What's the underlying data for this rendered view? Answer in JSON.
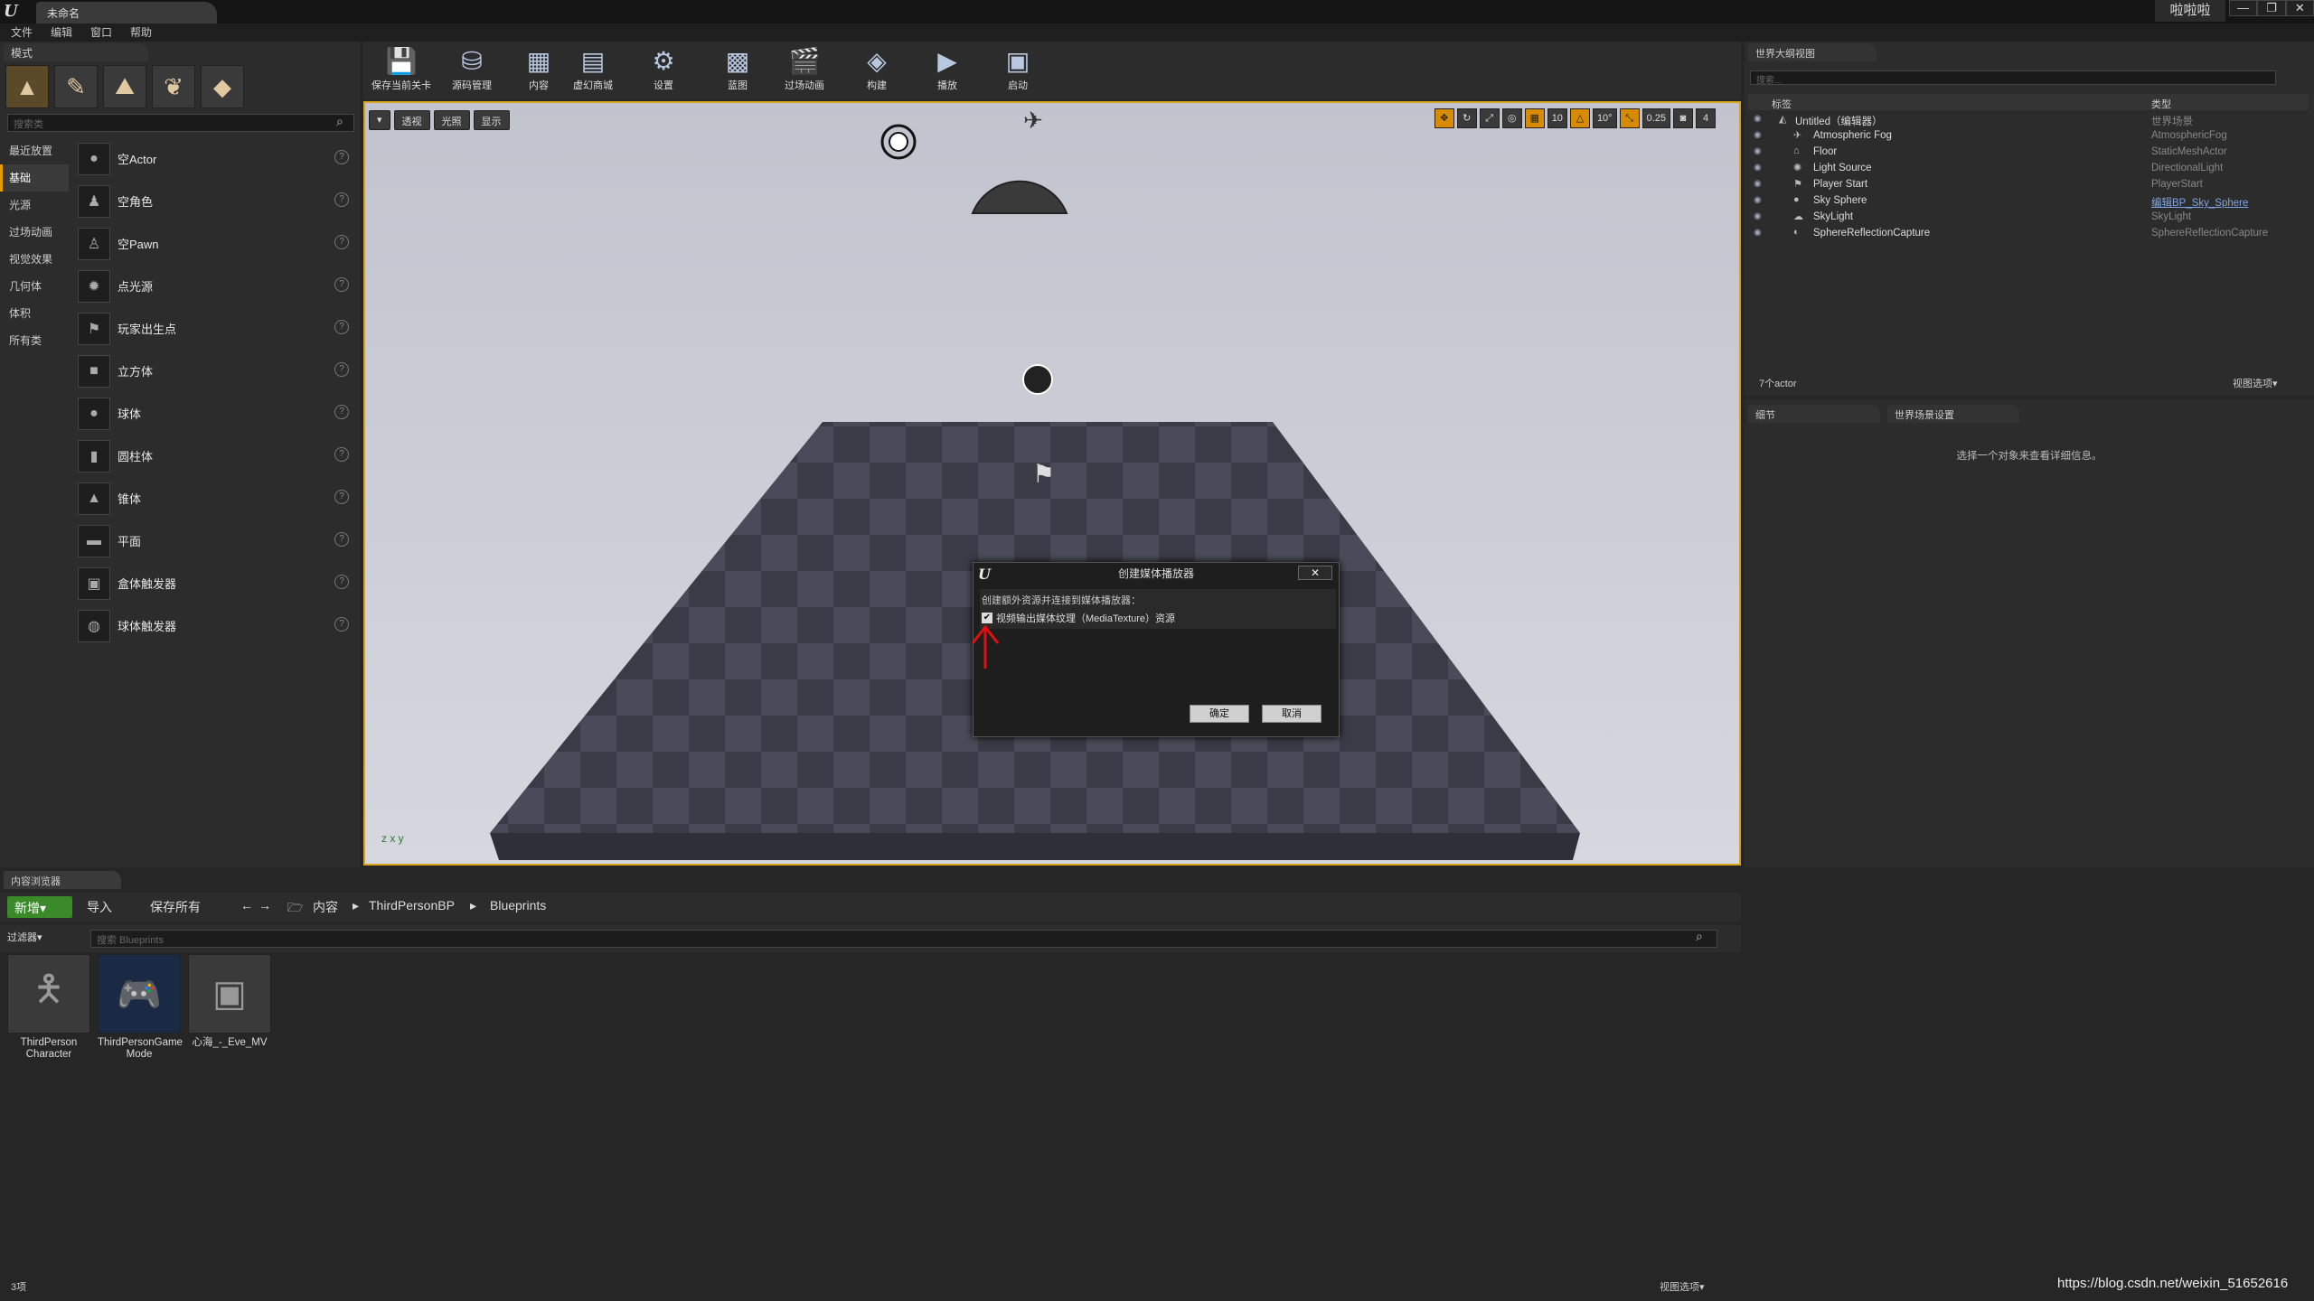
{
  "titlebar": {
    "tab": "未命名",
    "user": "啦啦啦",
    "win_min": "—",
    "win_max": "❐",
    "win_close": "✕"
  },
  "menu": [
    "文件",
    "编辑",
    "窗口",
    "帮助"
  ],
  "modes": {
    "tab": "模式",
    "search_placeholder": "搜索类",
    "categories": [
      "最近放置",
      "基础",
      "光源",
      "过场动画",
      "视觉效果",
      "几何体",
      "体积",
      "所有类"
    ],
    "selected_category": "基础",
    "items": [
      "空Actor",
      "空角色",
      "空Pawn",
      "点光源",
      "玩家出生点",
      "立方体",
      "球体",
      "圆柱体",
      "锥体",
      "平面",
      "盒体触发器",
      "球体触发器"
    ]
  },
  "toolbar": [
    "保存当前关卡",
    "源码管理",
    "内容",
    "虚幻商城",
    "设置",
    "蓝图",
    "过场动画",
    "构建",
    "播放",
    "启动"
  ],
  "viewport": {
    "left_opts": [
      "▾",
      "透视",
      "光照",
      "显示"
    ],
    "right_vals": {
      "grid": "10",
      "rot": "10°",
      "scale": "0.25",
      "cam": "4"
    }
  },
  "dialog": {
    "title": "创建媒体播放器",
    "close": "✕",
    "message": "创建额外资源并连接到媒体播放器：",
    "checkbox_label": "视频输出媒体纹理（MediaTexture）资源",
    "checked": true,
    "ok": "确定",
    "cancel": "取消"
  },
  "outliner": {
    "tab": "世界大纲视图",
    "search_placeholder": "搜索...",
    "col_label": "标签",
    "col_type": "类型",
    "rows": [
      {
        "name": "Untitled（编辑器）",
        "type": "世界场景"
      },
      {
        "name": "Atmospheric Fog",
        "type": "AtmosphericFog"
      },
      {
        "name": "Floor",
        "type": "StaticMeshActor"
      },
      {
        "name": "Light Source",
        "type": "DirectionalLight"
      },
      {
        "name": "Player Start",
        "type": "PlayerStart"
      },
      {
        "name": "Sky Sphere",
        "type": "编辑BP_Sky_Sphere"
      },
      {
        "name": "SkyLight",
        "type": "SkyLight"
      },
      {
        "name": "SphereReflectionCapture",
        "type": "SphereReflectionCapture"
      }
    ],
    "count": "7个actor",
    "view_options": "视图选项▾"
  },
  "details": {
    "tabs": [
      "细节",
      "世界场景设置"
    ],
    "empty_msg": "选择一个对象来查看详细信息。"
  },
  "content_browser": {
    "tab": "内容浏览器",
    "new": "新增▾",
    "import": "导入",
    "save_all": "保存所有",
    "path": [
      "内容",
      "ThirdPersonBP",
      "Blueprints"
    ],
    "filters": "过滤器▾",
    "search_placeholder": "搜索 Blueprints",
    "assets": [
      {
        "name": "ThirdPerson Character",
        "icon": "person-icon"
      },
      {
        "name": "ThirdPersonGame Mode",
        "icon": "gamepad-icon"
      },
      {
        "name": "心海_-_Eve_MV",
        "icon": "media-player-icon"
      }
    ],
    "count": "3项",
    "view_options": "视图选项▾"
  },
  "watermark": "https://blog.csdn.net/weixin_51652616"
}
